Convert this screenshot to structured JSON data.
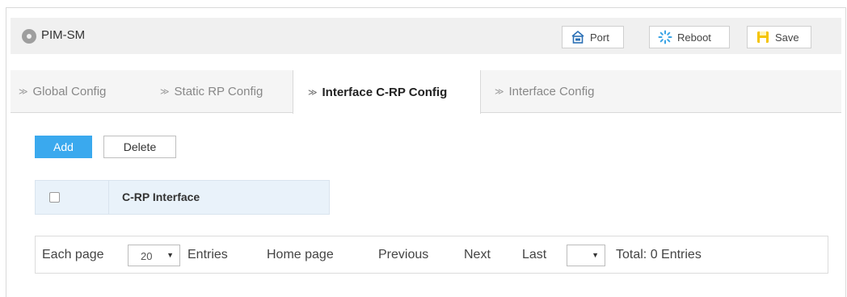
{
  "header": {
    "title": "PIM-SM",
    "port_label": "Port",
    "reboot_label": "Reboot",
    "save_label": "Save"
  },
  "tabs": [
    {
      "label": "Global Config",
      "active": false
    },
    {
      "label": "Static RP Config",
      "active": false
    },
    {
      "label": "Interface C-RP Config",
      "active": true
    },
    {
      "label": "Interface Config",
      "active": false
    }
  ],
  "toolbar": {
    "add_label": "Add",
    "delete_label": "Delete"
  },
  "table": {
    "columns": [
      "C-RP Interface"
    ],
    "rows": []
  },
  "pager": {
    "each_page_label": "Each page",
    "page_size": "20",
    "entries_label": "Entries",
    "home_label": "Home page",
    "previous_label": "Previous",
    "next_label": "Next",
    "last_label": "Last",
    "page_value": "",
    "total_label": "Total: 0 Entries"
  },
  "colors": {
    "accent": "#3aa9ee",
    "header_bg": "#f0f0f0",
    "table_header_bg": "#e9f2fa",
    "save_icon": "#f5c400",
    "port_icon": "#2a6fb5"
  }
}
